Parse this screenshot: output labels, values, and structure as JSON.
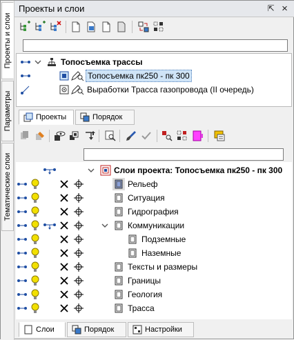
{
  "side_tabs": [
    "Проекты и слои",
    "Параметры",
    "Тематические слои"
  ],
  "window": {
    "title": "Проекты и слои",
    "pin_glyph": "⇱",
    "close_glyph": "×"
  },
  "projects_search": {
    "value": "",
    "placeholder": ""
  },
  "project_tree": {
    "root": "Топосъемка трассы",
    "items": [
      "Топосъемка пк250 - пк 300",
      "Выработки Трасса газопровода (II очередь)"
    ]
  },
  "middle_tabs": [
    "Проекты",
    "Порядок"
  ],
  "layers_search": {
    "value": "",
    "placeholder": ""
  },
  "layers": {
    "root": "Слои проекта: Топосъемка пк250 - пк 300",
    "items": [
      {
        "label": "Рельеф",
        "level": 0,
        "has_expand": false
      },
      {
        "label": "Ситуация",
        "level": 0,
        "has_expand": false
      },
      {
        "label": "Гидрография",
        "level": 0,
        "has_expand": false
      },
      {
        "label": "Коммуникации",
        "level": 0,
        "has_expand": true
      },
      {
        "label": "Подземные",
        "level": 1,
        "has_expand": false
      },
      {
        "label": "Наземные",
        "level": 1,
        "has_expand": false
      },
      {
        "label": "Тексты и размеры",
        "level": 0,
        "has_expand": false
      },
      {
        "label": "Границы",
        "level": 0,
        "has_expand": false
      },
      {
        "label": "Геология",
        "level": 0,
        "has_expand": false
      },
      {
        "label": "Трасса",
        "level": 0,
        "has_expand": false
      }
    ]
  },
  "bottom_tabs": [
    "Слои",
    "Порядок",
    "Настройки"
  ],
  "colors": {
    "accent": "#1f4ea3",
    "bulb": "#f2e000",
    "selection": "#cfe4f7",
    "title_bar": "#e6e8ec"
  }
}
